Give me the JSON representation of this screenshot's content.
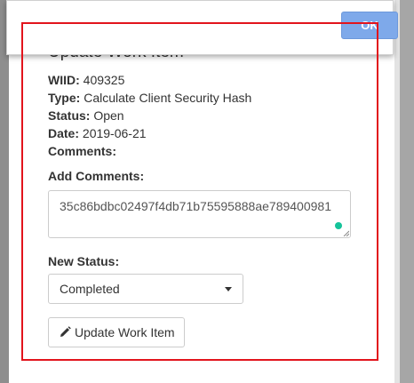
{
  "dialog": {
    "ok_label": "OK"
  },
  "panel": {
    "title": "Update Work Item",
    "info": [
      {
        "label": "WIID:",
        "value": "409325"
      },
      {
        "label": "Type:",
        "value": "Calculate Client Security Hash"
      },
      {
        "label": "Status:",
        "value": "Open"
      },
      {
        "label": "Date:",
        "value": "2019-06-21"
      },
      {
        "label": "Comments:",
        "value": ""
      }
    ],
    "add_comments_label": "Add Comments:",
    "comments_value": "35c86bdbc02497f4db71b75595888ae789400981",
    "new_status_label": "New Status:",
    "new_status_selected": "Completed",
    "update_button_label": "Update Work Item"
  },
  "icons": {
    "pencil": "pencil-icon",
    "caret": "caret-down-icon",
    "grammarly": "grammarly-dot-icon"
  },
  "colors": {
    "ok_button": "#7ea9ea",
    "highlight": "#e2141c",
    "grammarly": "#15c39a"
  }
}
